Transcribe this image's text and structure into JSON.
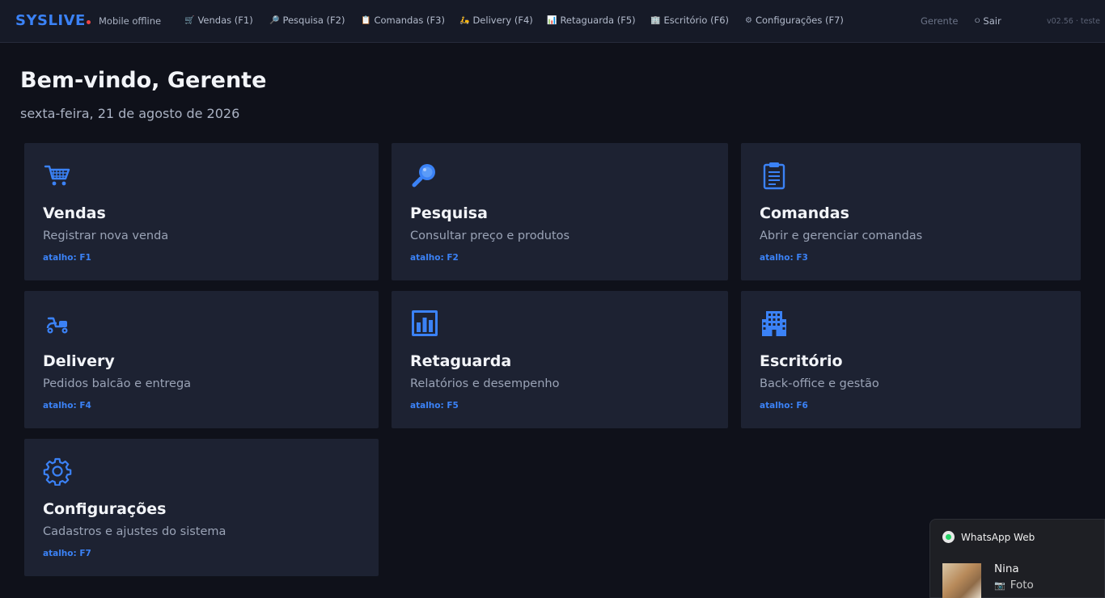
{
  "header": {
    "brand": "SYSLIVE",
    "status": "Mobile offline",
    "nav": [
      {
        "icon": "cart-icon",
        "glyph": "🛒",
        "label": "Vendas (F1)"
      },
      {
        "icon": "search-icon",
        "glyph": "🔎",
        "label": "Pesquisa (F2)"
      },
      {
        "icon": "clipboard-icon",
        "glyph": "📋",
        "label": "Comandas (F3)"
      },
      {
        "icon": "scooter-icon",
        "glyph": "🛵",
        "label": "Delivery (F4)"
      },
      {
        "icon": "chart-icon",
        "glyph": "📊",
        "label": "Retaguarda (F5)"
      },
      {
        "icon": "building-icon",
        "glyph": "🏢",
        "label": "Escritório (F6)"
      },
      {
        "icon": "gear-icon",
        "glyph": "⚙",
        "label": "Configurações (F7)"
      }
    ],
    "user": "Gerente",
    "logout": "Sair",
    "version": "v02.56 · teste"
  },
  "main": {
    "welcome": "Bem-vindo, Gerente",
    "date": "sexta-feira, 21 de agosto de 2026",
    "cards": [
      {
        "icon": "cart-icon",
        "title": "Vendas",
        "desc": "Registrar nova venda",
        "shortcut": "atalho: F1"
      },
      {
        "icon": "search-icon",
        "title": "Pesquisa",
        "desc": "Consultar preço e produtos",
        "shortcut": "atalho: F2"
      },
      {
        "icon": "clipboard-icon",
        "title": "Comandas",
        "desc": "Abrir e gerenciar comandas",
        "shortcut": "atalho: F3"
      },
      {
        "icon": "scooter-icon",
        "title": "Delivery",
        "desc": "Pedidos balcão e entrega",
        "shortcut": "atalho: F4"
      },
      {
        "icon": "chart-icon",
        "title": "Retaguarda",
        "desc": "Relatórios e desempenho",
        "shortcut": "atalho: F5"
      },
      {
        "icon": "building-icon",
        "title": "Escritório",
        "desc": "Back-office e gestão",
        "shortcut": "atalho: F6"
      },
      {
        "icon": "gear-icon",
        "title": "Configurações",
        "desc": "Cadastros e ajustes do sistema",
        "shortcut": "atalho: F7"
      }
    ]
  },
  "notification": {
    "app": "WhatsApp Web",
    "sender": "Nina",
    "message": "Foto"
  },
  "colors": {
    "accent": "#3b82f6",
    "background": "#0f111a",
    "card": "#1d2232",
    "status_dot": "#ef4444"
  }
}
